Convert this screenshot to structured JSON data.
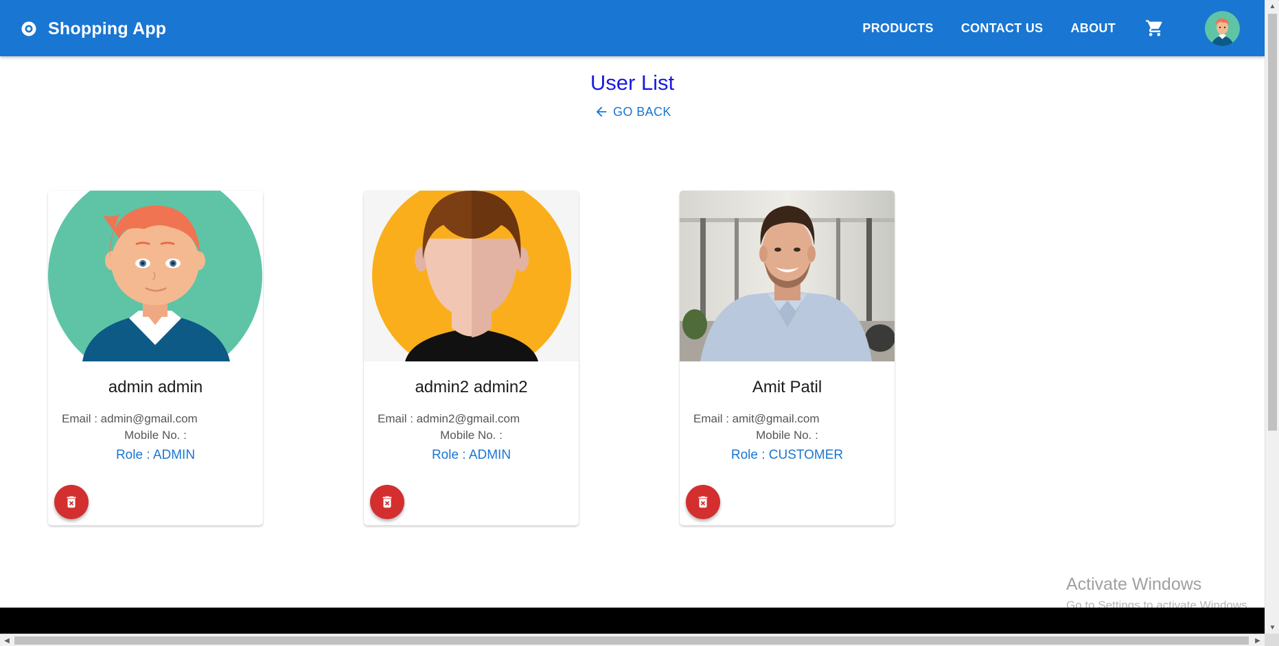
{
  "appbar": {
    "logo_icon": "circle-dot-logo-icon",
    "title": "Shopping App",
    "nav": [
      {
        "label": "PRODUCTS"
      },
      {
        "label": "CONTACT US"
      },
      {
        "label": "ABOUT"
      }
    ],
    "cart_icon": "shopping-cart-icon",
    "avatar_icon": "user-avatar",
    "color": "#1976d2"
  },
  "page": {
    "title": "User List",
    "go_back_label": "GO BACK",
    "go_back_icon": "arrow-left-icon",
    "title_color": "#1a1ae0"
  },
  "users": [
    {
      "name": "admin admin",
      "email_label": "Email : admin@gmail.com",
      "mobile_label": "Mobile No. :",
      "role_label": "Role : ADMIN",
      "avatar": "cartoon-boy-avatar"
    },
    {
      "name": "admin2 admin2",
      "email_label": "Email : admin2@gmail.com",
      "mobile_label": "Mobile No. :",
      "role_label": "Role : ADMIN",
      "avatar": "faceless-person-avatar"
    },
    {
      "name": "Amit Patil",
      "email_label": "Email : amit@gmail.com",
      "mobile_label": "Mobile No. :",
      "role_label": "Role : CUSTOMER",
      "avatar": "photo-man-in-office"
    }
  ],
  "delete_icon": "trash-delete-icon",
  "delete_color": "#d32f2f",
  "watermark": {
    "title": "Activate Windows",
    "subtitle": "Go to Settings to activate Windows."
  }
}
